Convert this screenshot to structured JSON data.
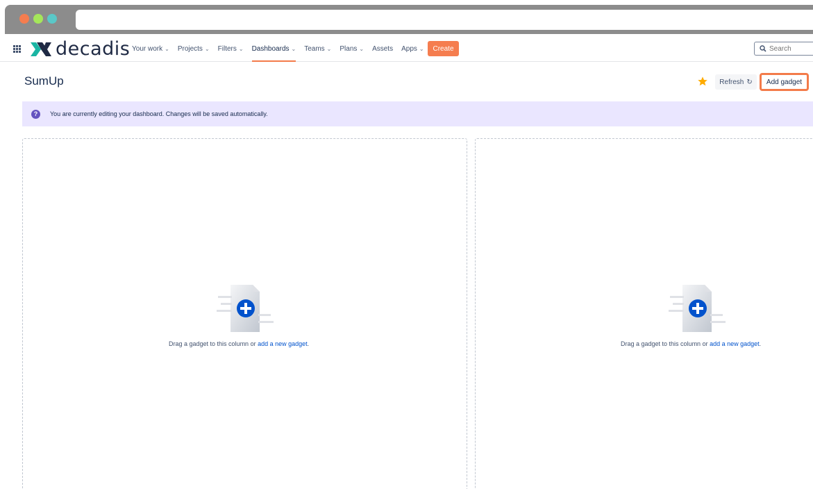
{
  "colors": {
    "traffic_red": "#f57d4f",
    "traffic_yellow": "#a5e65a",
    "traffic_green": "#5ac8c8",
    "accent_orange": "#f37b4a",
    "link_blue": "#0052cc",
    "banner_bg": "#eae6ff",
    "help_purple": "#6554c0",
    "star_gold": "#ffab00"
  },
  "nav": {
    "logo_text": "decadis",
    "items": [
      {
        "label": "Your work",
        "dropdown": true
      },
      {
        "label": "Projects",
        "dropdown": true
      },
      {
        "label": "Filters",
        "dropdown": true
      },
      {
        "label": "Dashboards",
        "dropdown": true,
        "active": true
      },
      {
        "label": "Teams",
        "dropdown": true
      },
      {
        "label": "Plans",
        "dropdown": true
      },
      {
        "label": "Assets",
        "dropdown": false
      },
      {
        "label": "Apps",
        "dropdown": true
      }
    ],
    "create_label": "Create",
    "search_placeholder": "Search"
  },
  "header": {
    "title": "SumUp",
    "refresh_label": "Refresh",
    "add_gadget_label": "Add gadget"
  },
  "banner": {
    "text": "You are currently editing your dashboard. Changes will be saved automatically."
  },
  "columns": [
    {
      "drop_text": "Drag a gadget to this column or ",
      "link_text": "add a new gadget",
      "suffix": "."
    },
    {
      "drop_text": "Drag a gadget to this column or ",
      "link_text": "add a new gadget",
      "suffix": "."
    }
  ]
}
